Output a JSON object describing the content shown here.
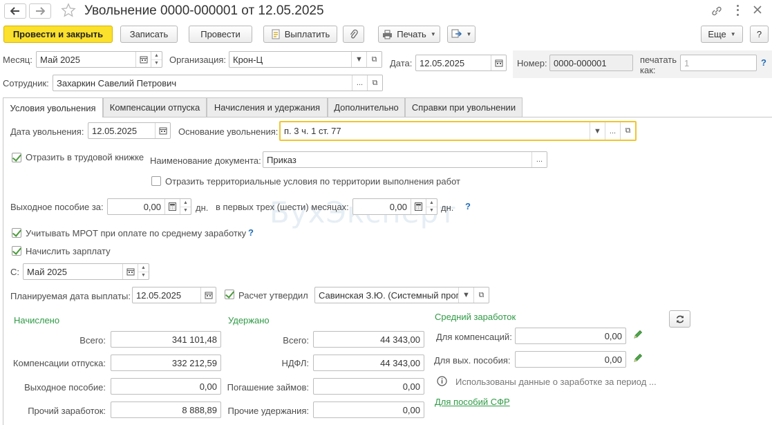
{
  "window": {
    "title": "Увольнение 0000-000001 от 12.05.2025"
  },
  "toolbar": {
    "post_close": "Провести и закрыть",
    "save": "Записать",
    "post": "Провести",
    "pay": "Выплатить",
    "print": "Печать",
    "more": "Еще",
    "help": "?"
  },
  "header": {
    "month_label": "Месяц:",
    "month_value": "Май 2025",
    "org_label": "Организация:",
    "org_value": "Крон-Ц",
    "date_label": "Дата:",
    "date_value": "12.05.2025",
    "number_label": "Номер:",
    "number_value": "0000-000001",
    "print_as_label": "печатать как:",
    "print_as_value": "1",
    "help": "?",
    "employee_label": "Сотрудник:",
    "employee_value": "Захаркин Савелий Петрович"
  },
  "tabs": [
    {
      "label": "Условия увольнения"
    },
    {
      "label": "Компенсации отпуска"
    },
    {
      "label": "Начисления и удержания"
    },
    {
      "label": "Дополнительно"
    },
    {
      "label": "Справки при увольнении"
    }
  ],
  "conditions": {
    "dismissal_date_label": "Дата увольнения:",
    "dismissal_date_value": "12.05.2025",
    "reason_label": "Основание увольнения:",
    "reason_value": "п. 3 ч. 1 ст. 77",
    "workbook_label": "Отразить в трудовой книжке",
    "doc_name_label": "Наименование документа:",
    "doc_name_value": "Приказ",
    "territorial_label": "Отразить территориальные условия по территории выполнения работ",
    "severance_label": "Выходное пособие за:",
    "severance_value": "0,00",
    "days_unit": "дн.",
    "first_months_label": "в первых трех (шести) месяцах:",
    "first_months_value": "0,00",
    "days_unit2": "дн.",
    "help": "?",
    "mrot_label": "Учитывать МРОТ при оплате по среднему заработку",
    "mrot_help": "?",
    "accrue_label": "Начислить зарплату",
    "from_label": "С:",
    "from_value": "Май 2025",
    "planned_date_label": "Планируемая дата выплаты:",
    "planned_date_value": "12.05.2025",
    "approved_label": "Расчет утвердил",
    "approved_value": "Савинская З.Ю. (Системный прог"
  },
  "accrued": {
    "title": "Начислено",
    "rows": [
      {
        "label": "Всего:",
        "value": "341 101,48"
      },
      {
        "label": "Компенсации отпуска:",
        "value": "332 212,59"
      },
      {
        "label": "Выходное пособие:",
        "value": "0,00"
      },
      {
        "label": "Прочий заработок:",
        "value": "8 888,89"
      }
    ]
  },
  "withheld": {
    "title": "Удержано",
    "rows": [
      {
        "label": "Всего:",
        "value": "44 343,00"
      },
      {
        "label": "НДФЛ:",
        "value": "44 343,00"
      },
      {
        "label": "Погашение займов:",
        "value": "0,00"
      },
      {
        "label": "Прочие удержания:",
        "value": "0,00"
      }
    ]
  },
  "average": {
    "title": "Средний заработок",
    "compensation_label": "Для компенсаций:",
    "compensation_value": "0,00",
    "severance_label": "Для вых. пособия:",
    "severance_value": "0,00",
    "info_text": "Использованы данные о заработке за период ...",
    "sfr_link": "Для пособий СФР"
  },
  "watermark": "БухЭксперт"
}
